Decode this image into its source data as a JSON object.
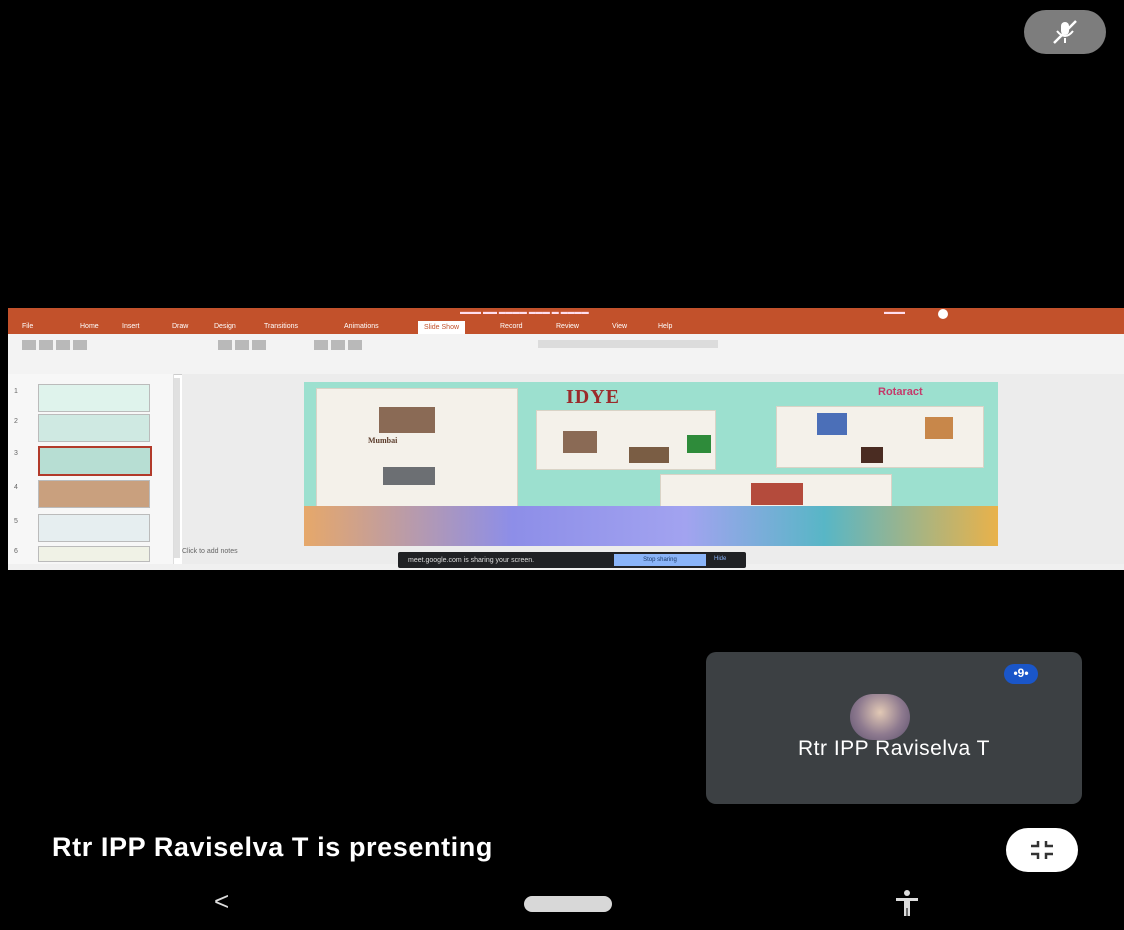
{
  "meeting": {
    "presenting_text": "Rtr IPP Raviselva T is presenting",
    "participant_name": "Rtr IPP Raviselva T",
    "more_options_label": "•9•",
    "icons": {
      "mic": "mic-off-icon",
      "fullscreen": "exit-fullscreen-icon",
      "avatar": "participant-avatar"
    }
  },
  "shared_screen": {
    "app": "PowerPoint",
    "accent_color": "#c2512b",
    "ribbon_tabs": [
      "File",
      "Home",
      "Insert",
      "Draw",
      "Design",
      "Transitions",
      "Animations",
      "Slide Show",
      "Record",
      "Review",
      "View",
      "Help"
    ],
    "active_tab": "Slide Show",
    "slide": {
      "title": "IDYE",
      "brand": "Rotaract",
      "city_label": "Mumbai"
    },
    "notes_placeholder": "Click to add notes",
    "share_banner": {
      "text": "meet.google.com is sharing your screen.",
      "stop_button": "Stop sharing",
      "hide_button": "Hide"
    }
  },
  "android_nav": {
    "back": "<",
    "icons": [
      "back-icon",
      "home-pill-icon",
      "accessibility-icon"
    ]
  },
  "colors": {
    "tile_background": "#3c4043",
    "more_button": "#1a56c9",
    "slide_background": "#9ce0cf"
  }
}
